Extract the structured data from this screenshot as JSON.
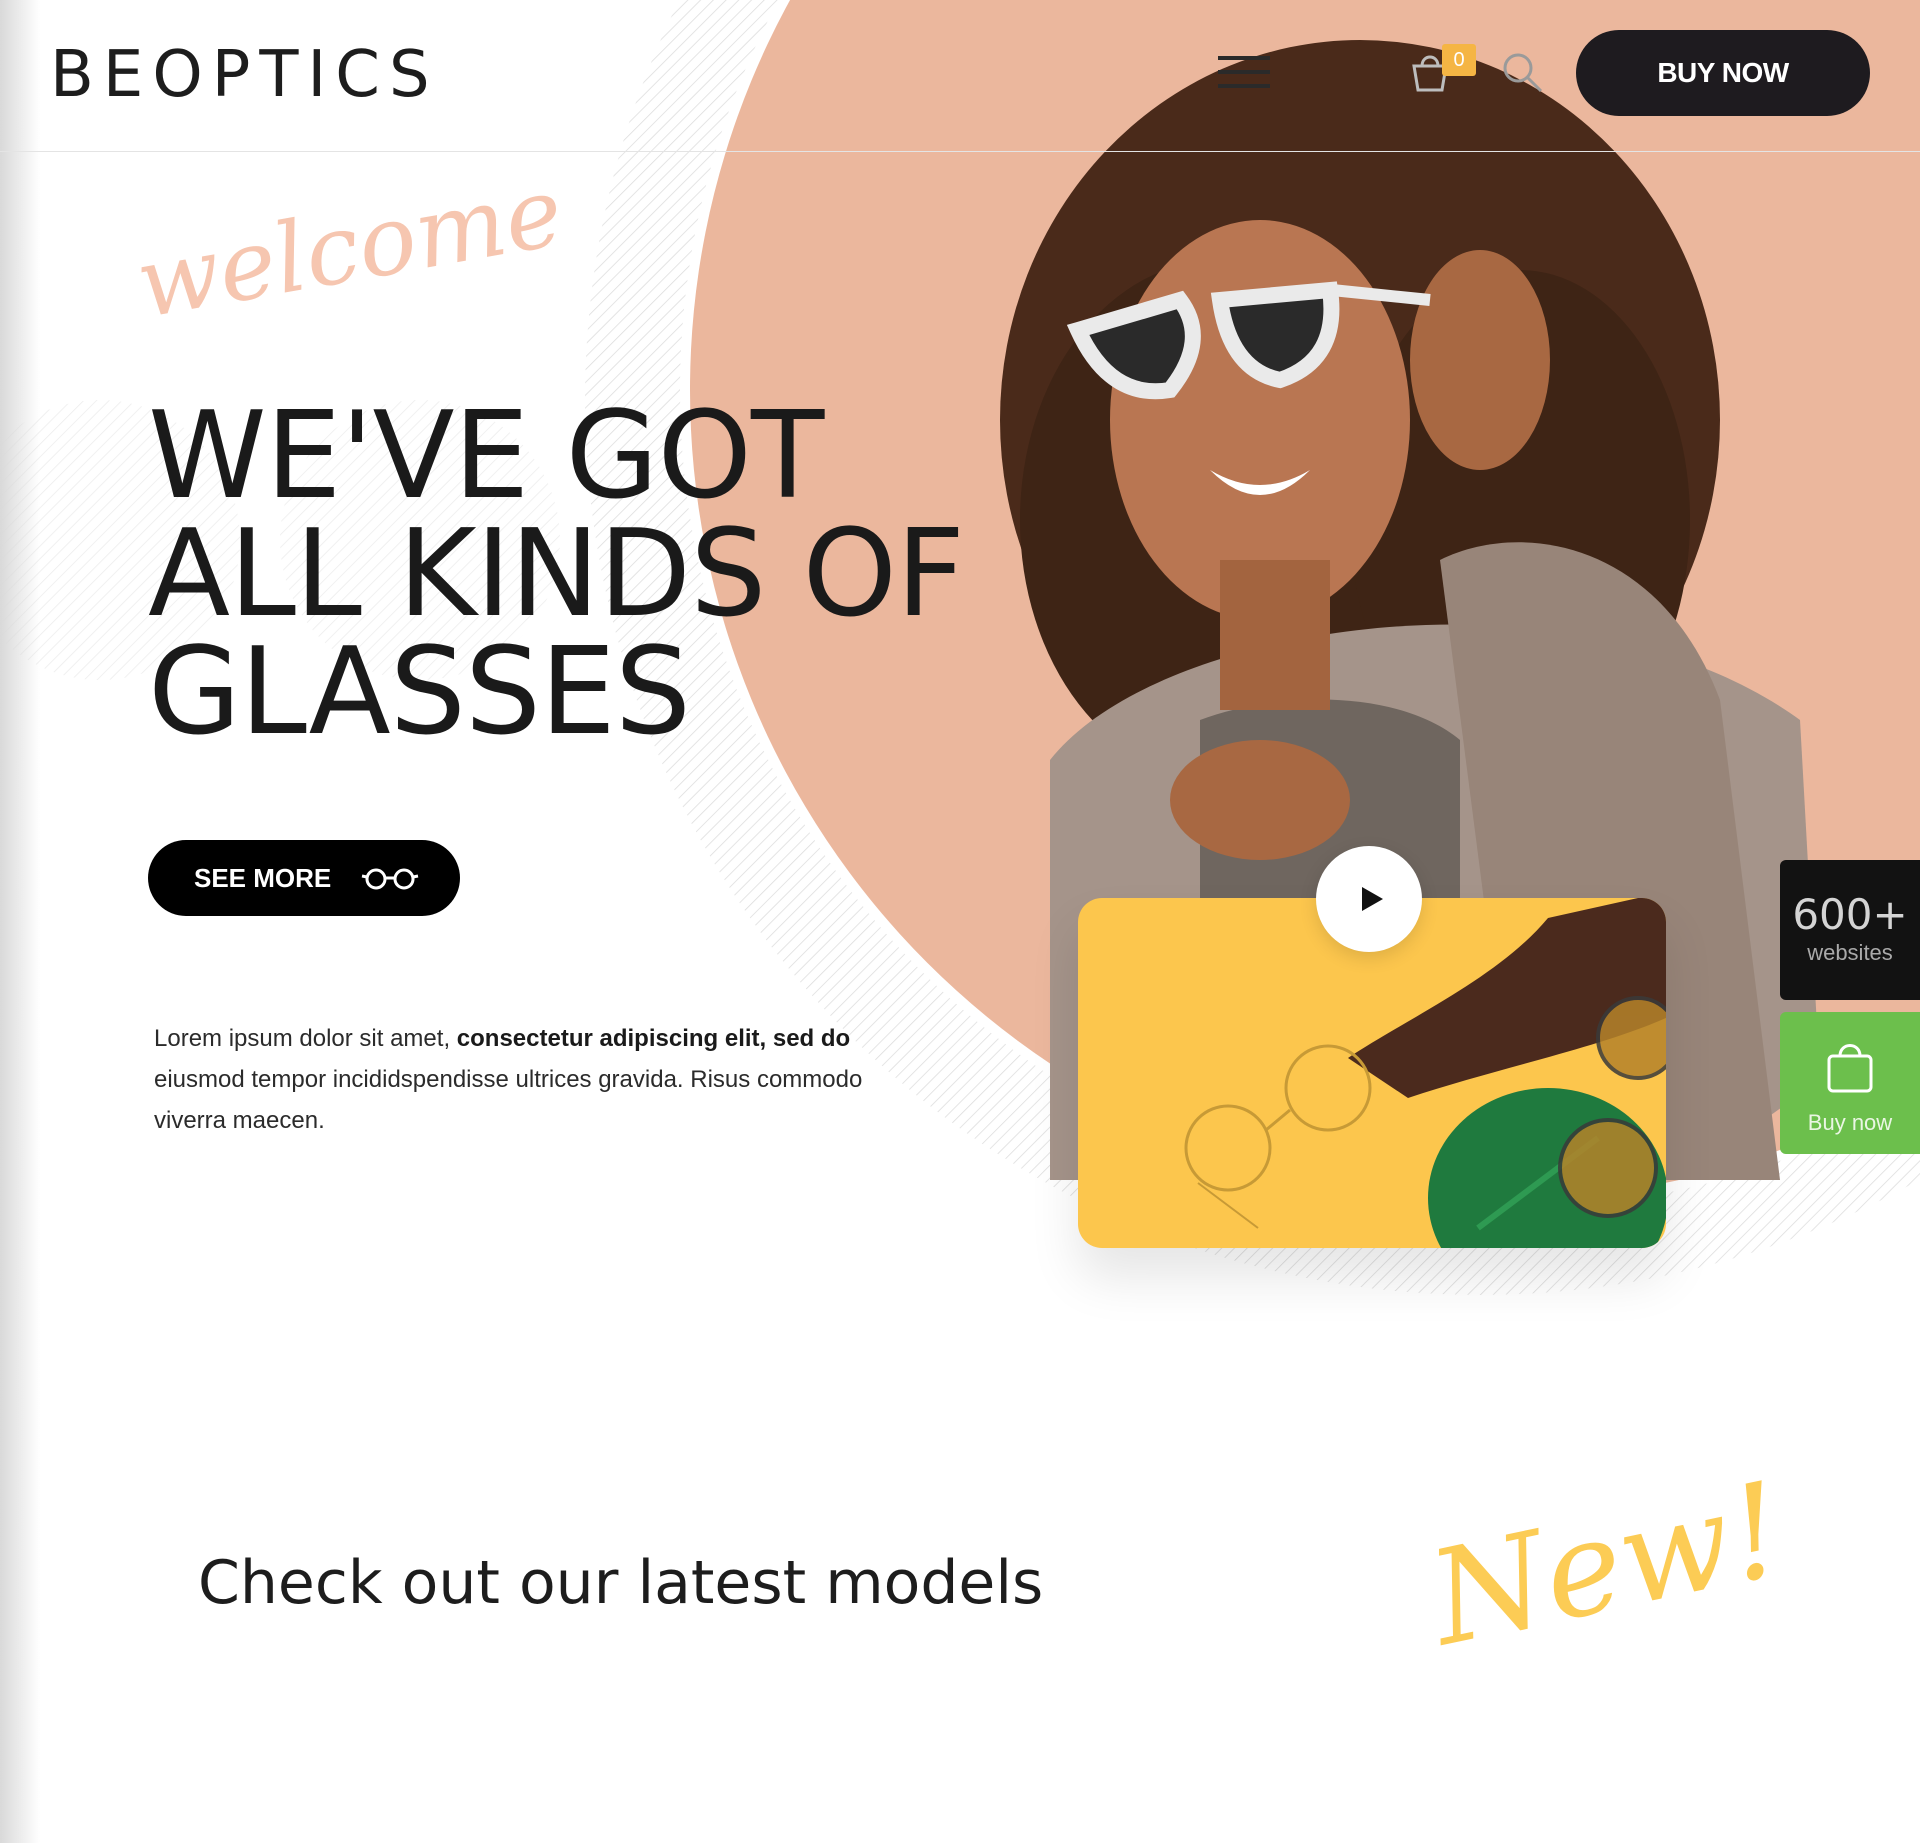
{
  "header": {
    "logo": "BEOPTICS",
    "cart_count": "0",
    "buy_now_label": "BUY NOW"
  },
  "hero": {
    "welcome": "welcome",
    "headline": [
      "WE'VE GOT",
      "ALL KINDS OF",
      "GLASSES"
    ],
    "see_more_label": "SEE MORE",
    "intro_regular_1": "Lorem ipsum dolor sit amet, ",
    "intro_bold": "consectetur adipiscing elit, sed do",
    "intro_regular_2": " eiusmod tempor incididspendisse ultrices gravida. Risus commodo viverra maecen."
  },
  "side_widgets": {
    "counter_value": "600+",
    "counter_label": "websites",
    "buy_label": "Buy now"
  },
  "latest": {
    "title": "Check out our latest models",
    "script_label": "New!"
  },
  "colors": {
    "peach": "#ebb79d",
    "accent_welcome": "#f6c6b0",
    "accent_new": "#fccc55",
    "video_bg": "#fcc64d",
    "buy_green": "#6cbf4c",
    "dark": "#1e1b1f"
  },
  "icons": [
    "menu-icon",
    "cart-icon",
    "search-icon",
    "glasses-icon",
    "play-icon",
    "shopping-bag-icon"
  ]
}
